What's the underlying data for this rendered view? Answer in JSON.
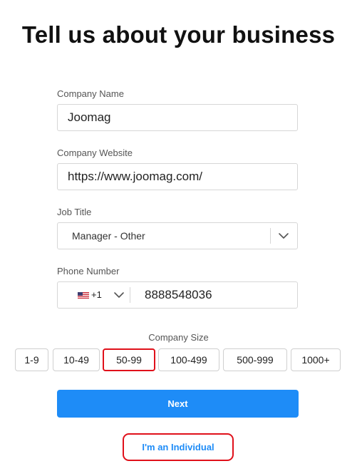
{
  "page": {
    "title": "Tell us about your business"
  },
  "company_name": {
    "label": "Company Name",
    "value": "Joomag"
  },
  "company_website": {
    "label": "Company Website",
    "value": "https://www.joomag.com/"
  },
  "job_title": {
    "label": "Job Title",
    "value": "Manager - Other",
    "chevron_icon": "chevron-down-icon"
  },
  "phone": {
    "label": "Phone Number",
    "country_flag": "us-flag-icon",
    "country_code": "+1",
    "number": "8888548036"
  },
  "company_size": {
    "label": "Company Size",
    "options": [
      "1-9",
      "10-49",
      "50-99",
      "100-499",
      "500-999",
      "1000+"
    ],
    "selected": "50-99"
  },
  "actions": {
    "next_label": "Next",
    "individual_label": "I'm an Individual"
  },
  "colors": {
    "primary": "#1e8cf7",
    "highlight": "#e0101a",
    "border": "#d6d6d6"
  }
}
